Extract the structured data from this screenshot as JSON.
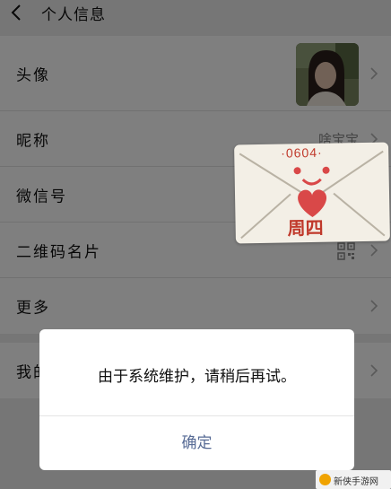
{
  "header": {
    "title": "个人信息"
  },
  "rows": [
    {
      "label": "头像"
    },
    {
      "label": "昵称",
      "value": "啥宝宝"
    },
    {
      "label": "微信号"
    },
    {
      "label": "二维码名片"
    },
    {
      "label": "更多"
    }
  ],
  "rows2": [
    {
      "label": "我的地址"
    }
  ],
  "sticker": {
    "date": "·0604·",
    "text": "周四"
  },
  "dialog": {
    "message": "由于系统维护，请稍后再试。",
    "confirm": "确定"
  },
  "watermark": {
    "text": "新侠手游网"
  },
  "colors": {
    "link": "#576b95",
    "background": "#ededed",
    "stamp": "#c0392b"
  }
}
